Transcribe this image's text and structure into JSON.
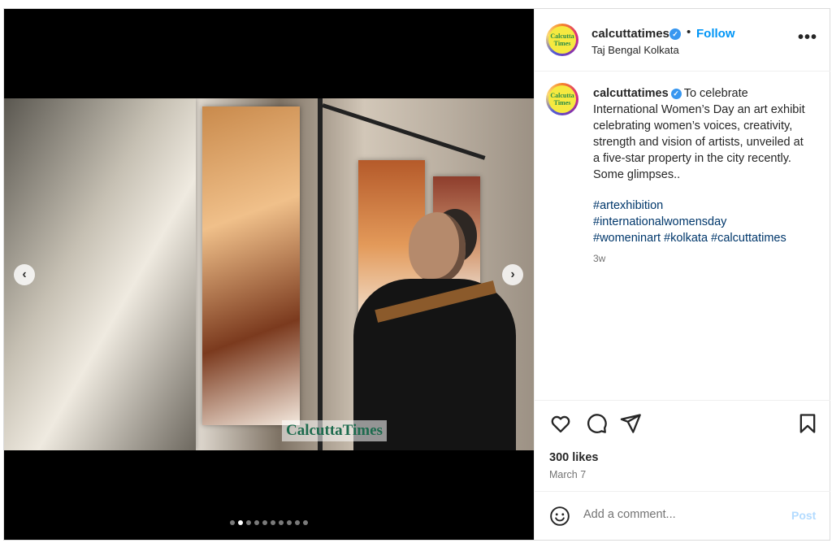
{
  "media": {
    "watermark": "CalcuttaTimes",
    "prev_icon": "chevron-left-icon",
    "next_icon": "chevron-right-icon",
    "carousel": {
      "count": 10,
      "active_index": 1
    }
  },
  "header": {
    "username": "calcuttatimes",
    "avatar_text": "Calcutta Times",
    "verified_icon": "verified-badge-icon",
    "separator": "•",
    "follow_label": "Follow",
    "location": "Taj Bengal Kolkata",
    "more_label": "•••"
  },
  "caption": {
    "username": "calcuttatimes",
    "text": "To celebrate International Women’s Day an art exhibit celebrating women’s voices, creativity, strength and vision of artists, unveiled at a five-star property in the city recently. Some glimpses..",
    "hashtags": [
      "#artexhibition",
      "#internationalwomensday",
      "#womeninart",
      "#kolkata",
      "#calcuttatimes"
    ],
    "time": "3w"
  },
  "actions": {
    "like_icon": "heart-icon",
    "comment_icon": "comment-icon",
    "share_icon": "send-icon",
    "save_icon": "bookmark-icon"
  },
  "stats": {
    "likes": "300 likes",
    "date": "March 7"
  },
  "comment": {
    "emoji_icon": "emoji-icon",
    "placeholder": "Add a comment...",
    "post_label": "Post"
  },
  "colors": {
    "accent": "#0095f6",
    "verified": "#3897f0",
    "hashtag": "#00376b"
  }
}
